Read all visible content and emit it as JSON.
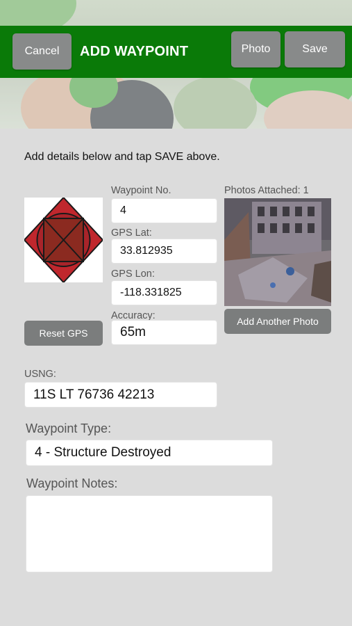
{
  "header": {
    "cancel_label": "Cancel",
    "title": "ADD WAYPOINT",
    "photo_label": "Photo",
    "save_label": "Save",
    "color": "#0a7a08"
  },
  "instructions": "Add details below and tap SAVE above.",
  "symbol": {
    "icon": "structure-destroyed-symbol-icon",
    "fill": "#c0272d"
  },
  "fields": {
    "waypoint_no": {
      "label": "Waypoint No.",
      "value": "4"
    },
    "gps_lat": {
      "label": "GPS Lat:",
      "value": "33.812935"
    },
    "gps_lon": {
      "label": "GPS Lon:",
      "value": "-118.331825"
    },
    "accuracy": {
      "label": "Accuracy:",
      "value": "65m"
    },
    "usng": {
      "label": "USNG:",
      "value": "11S LT 76736 42213"
    },
    "waypoint_type": {
      "label": "Waypoint Type:",
      "value": "4 - Structure Destroyed"
    },
    "waypoint_notes": {
      "label": "Waypoint Notes:",
      "value": ""
    }
  },
  "photos": {
    "attached_label": "Photos Attached: 1",
    "add_another_label": "Add Another Photo"
  },
  "reset_gps_label": "Reset GPS"
}
